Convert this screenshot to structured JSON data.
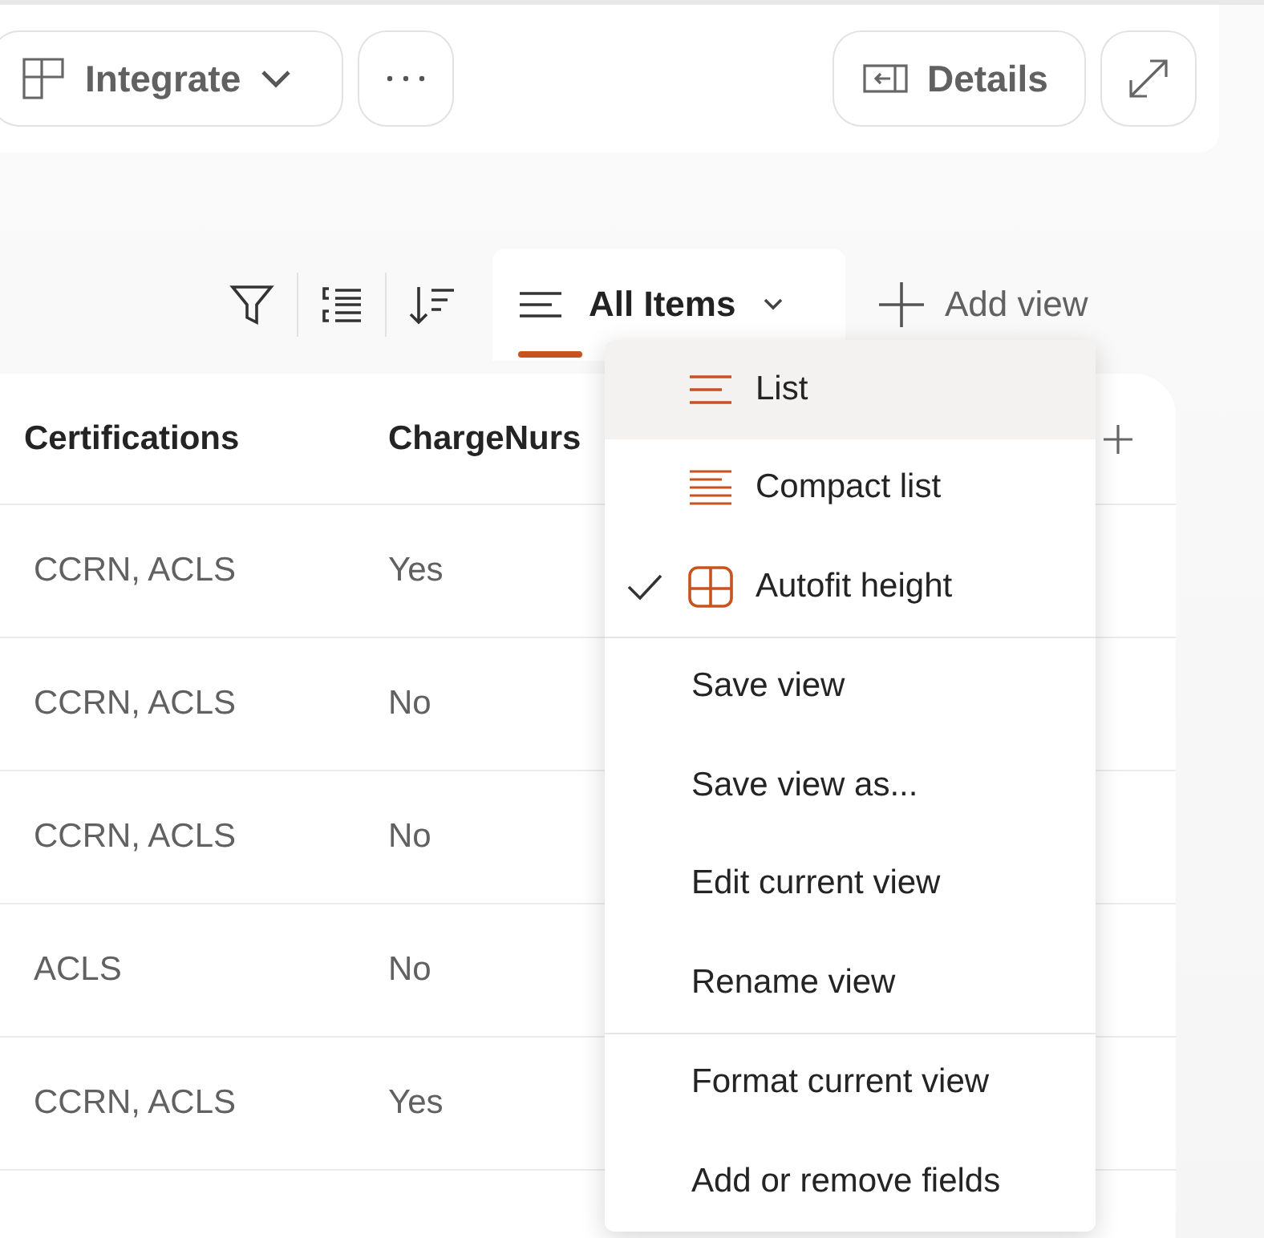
{
  "command_bar": {
    "integrate": {
      "label": "Integrate"
    },
    "details": {
      "label": "Details"
    }
  },
  "view_bar": {
    "view_tab": {
      "label": "All Items",
      "selected": true
    },
    "add_view": {
      "label": "Add view"
    }
  },
  "table": {
    "columns": [
      "Certifications",
      "ChargeNurs"
    ],
    "rows": [
      [
        "CCRN, ACLS",
        "Yes"
      ],
      [
        "CCRN, ACLS",
        "No"
      ],
      [
        "CCRN, ACLS",
        "No"
      ],
      [
        "ACLS",
        "No"
      ],
      [
        "CCRN, ACLS",
        "Yes"
      ]
    ]
  },
  "view_menu": {
    "sections": [
      {
        "items": [
          {
            "kind": "list",
            "label": "List",
            "selected": true,
            "checked": false
          },
          {
            "kind": "compact",
            "label": "Compact list",
            "selected": false,
            "checked": false
          },
          {
            "kind": "autofit",
            "label": "Autofit height",
            "selected": false,
            "checked": true
          }
        ]
      },
      {
        "items": [
          {
            "kind": "plain",
            "label": "Save view",
            "selected": false
          },
          {
            "kind": "plain",
            "label": "Save view as...",
            "selected": false
          },
          {
            "kind": "plain",
            "label": "Edit current view",
            "selected": false
          },
          {
            "kind": "plain",
            "label": "Rename view",
            "selected": false
          }
        ]
      },
      {
        "items": [
          {
            "kind": "plain",
            "label": "Format current view",
            "selected": false
          },
          {
            "kind": "plain",
            "label": "Add or remove fields",
            "selected": false
          }
        ]
      }
    ]
  }
}
